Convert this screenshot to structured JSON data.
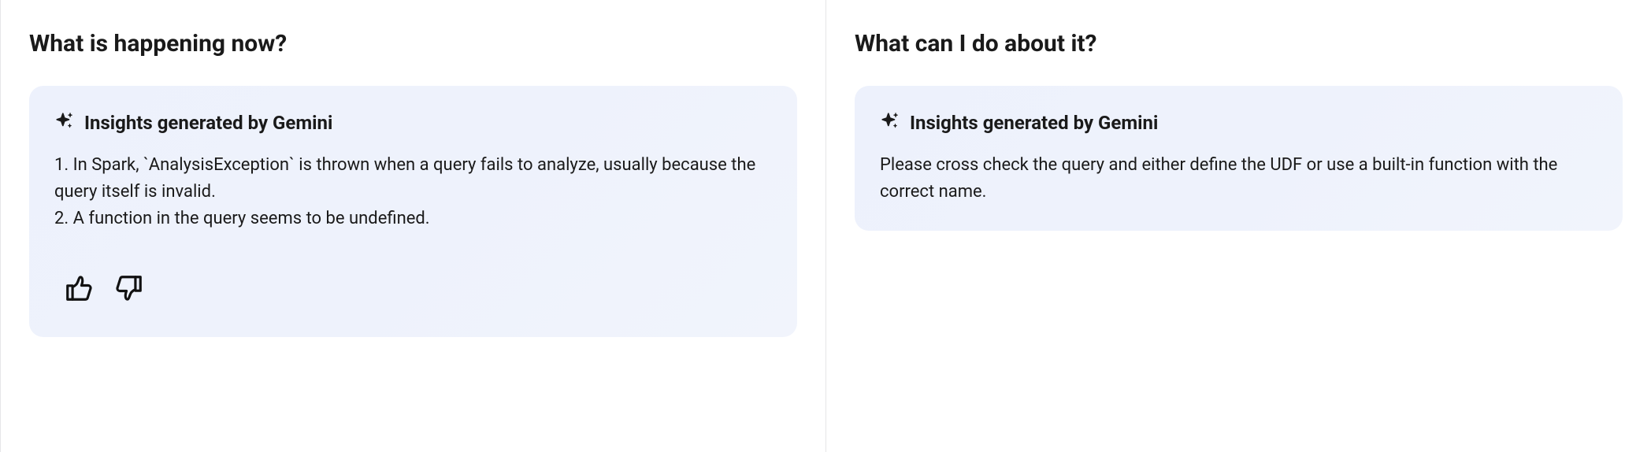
{
  "left": {
    "title": "What is happening now?",
    "insight_header": "Insights generated by Gemini",
    "insight_body": "1. In Spark, `AnalysisException` is thrown when a query fails to analyze, usually because the query itself is invalid.\n2. A function in the query seems to be undefined."
  },
  "right": {
    "title": "What can I do about it?",
    "insight_header": "Insights generated by Gemini",
    "insight_body": "Please cross check the query and either define the UDF or use a built-in function with the correct name."
  }
}
